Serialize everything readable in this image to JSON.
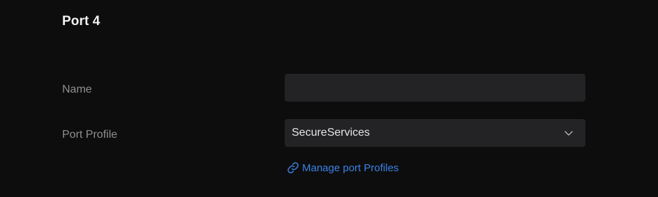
{
  "port": {
    "title": "Port 4"
  },
  "form": {
    "name": {
      "label": "Name",
      "value": "",
      "placeholder": ""
    },
    "port_profile": {
      "label": "Port Profile",
      "selected": "SecureServices"
    },
    "manage_link": {
      "label": "Manage port Profiles",
      "icon": "link-icon"
    }
  },
  "colors": {
    "background": "#0d0d0d",
    "field_background": "#232325",
    "label": "#8f8f8f",
    "title": "#f2f2f2",
    "link": "#3b82e6"
  }
}
